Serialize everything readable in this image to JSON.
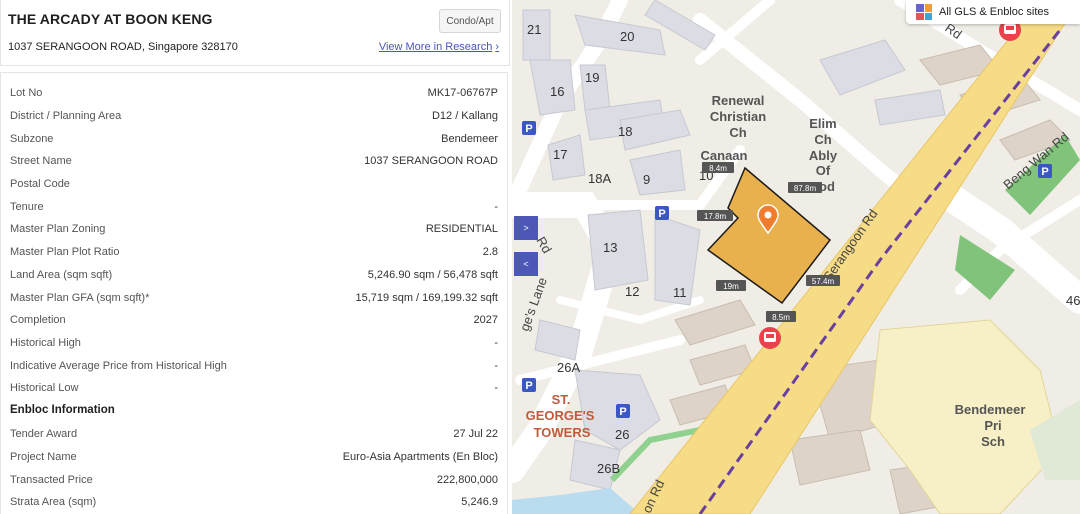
{
  "property": {
    "title": "THE ARCADY AT BOON KENG",
    "type_badge": "Condo/Apt",
    "address": "1037 SERANGOON ROAD, Singapore 328170",
    "view_more": "View More in Research"
  },
  "details": [
    {
      "label": "Lot No",
      "value": "MK17-06767P"
    },
    {
      "label": "District / Planning Area",
      "value": "D12 / Kallang"
    },
    {
      "label": "Subzone",
      "value": "Bendemeer"
    },
    {
      "label": "Street Name",
      "value": "1037 SERANGOON ROAD"
    },
    {
      "label": "Postal Code",
      "value": ""
    },
    {
      "label": "Tenure",
      "value": "-"
    },
    {
      "label": "Master Plan Zoning",
      "value": "RESIDENTIAL"
    },
    {
      "label": "Master Plan Plot Ratio",
      "value": "2.8"
    },
    {
      "label": "Land Area (sqm sqft)",
      "value": "5,246.90 sqm / 56,478 sqft"
    },
    {
      "label": "Master Plan GFA (sqm sqft)*",
      "value": "15,719 sqm / 169,199.32 sqft"
    },
    {
      "label": "Completion",
      "value": "2027"
    },
    {
      "label": "Historical High",
      "value": "-"
    },
    {
      "label": "Indicative Average Price from Historical High",
      "value": "-"
    },
    {
      "label": "Historical Low",
      "value": "-"
    }
  ],
  "enbloc": {
    "title": "Enbloc Information",
    "rows": [
      {
        "label": "Tender Award",
        "value": "27 Jul 22"
      },
      {
        "label": "Project Name",
        "value": "Euro-Asia Apartments (En Bloc)"
      },
      {
        "label": "Transacted Price",
        "value": "222,800,000"
      },
      {
        "label": "Strata Area (sqm)",
        "value": "5,246.9"
      }
    ]
  },
  "map": {
    "layer_toggle": "All GLS & Enbloc sites",
    "expand_icon": "chevron-right-icon",
    "collapse_icon": "chevron-left-icon",
    "building_numbers": [
      "21",
      "20",
      "19",
      "16",
      "18",
      "17",
      "18A",
      "9",
      "10",
      "13",
      "12",
      "11",
      "26A",
      "26",
      "26B",
      "46"
    ],
    "place_labels": [
      "Renewal",
      "Christian",
      "Ch",
      "Elim",
      "Ch",
      "Ably",
      "Of",
      "od",
      "Canaan",
      "ST.",
      "GEORGE'S",
      "TOWERS",
      "Bendemeer",
      "Pri",
      "Sch"
    ],
    "road_labels": [
      "Serangoon Rd",
      "Beng Wan Rd",
      "ge's Lane",
      "Rd",
      "Rd",
      "on Rd"
    ],
    "dimensions": [
      "8.4m",
      "87.8m",
      "17.8m",
      "19m",
      "57.4m",
      "8.5m"
    ],
    "colors": {
      "site_fill": "#e9b04e",
      "site_stroke": "#1b1b1b",
      "marker": "#f07c2e",
      "road_main": "#f7dc88",
      "mrt_line": "#6a3fa0",
      "bus_stop": "#e9424b",
      "parking": "#3b57c4"
    }
  }
}
